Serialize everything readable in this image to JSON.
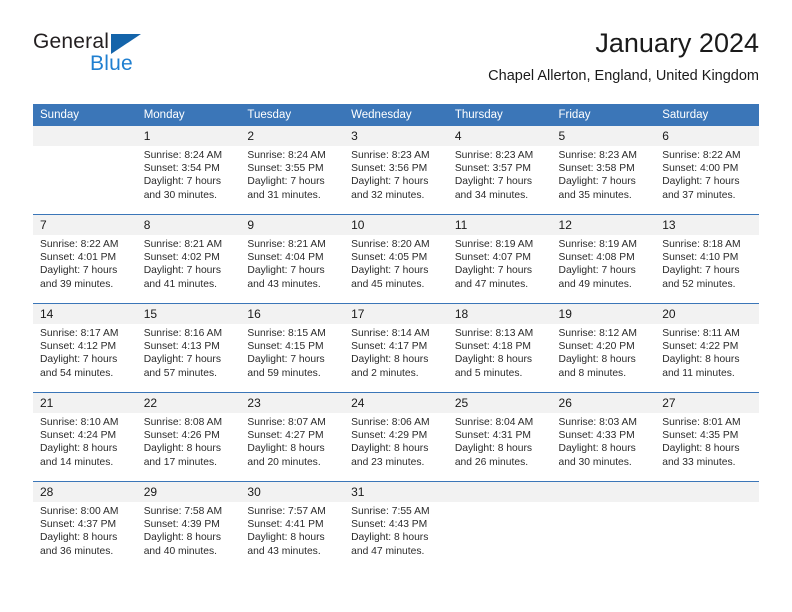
{
  "brand": {
    "name_part1": "General",
    "name_part2": "Blue",
    "triangle_color": "#1464aa",
    "blue_color": "#1f7fd0"
  },
  "header": {
    "title": "January 2024",
    "subtitle": "Chapel Allerton, England, United Kingdom",
    "header_bg": "#3b76b8",
    "daynum_bg": "#f2f2f2"
  },
  "weekday_headers": [
    "Sunday",
    "Monday",
    "Tuesday",
    "Wednesday",
    "Thursday",
    "Friday",
    "Saturday"
  ],
  "weeks": [
    [
      {
        "day": "",
        "sunrise": "",
        "sunset": "",
        "daylight_line1": "",
        "daylight_line2": ""
      },
      {
        "day": "1",
        "sunrise": "Sunrise: 8:24 AM",
        "sunset": "Sunset: 3:54 PM",
        "daylight_line1": "Daylight: 7 hours",
        "daylight_line2": "and 30 minutes."
      },
      {
        "day": "2",
        "sunrise": "Sunrise: 8:24 AM",
        "sunset": "Sunset: 3:55 PM",
        "daylight_line1": "Daylight: 7 hours",
        "daylight_line2": "and 31 minutes."
      },
      {
        "day": "3",
        "sunrise": "Sunrise: 8:23 AM",
        "sunset": "Sunset: 3:56 PM",
        "daylight_line1": "Daylight: 7 hours",
        "daylight_line2": "and 32 minutes."
      },
      {
        "day": "4",
        "sunrise": "Sunrise: 8:23 AM",
        "sunset": "Sunset: 3:57 PM",
        "daylight_line1": "Daylight: 7 hours",
        "daylight_line2": "and 34 minutes."
      },
      {
        "day": "5",
        "sunrise": "Sunrise: 8:23 AM",
        "sunset": "Sunset: 3:58 PM",
        "daylight_line1": "Daylight: 7 hours",
        "daylight_line2": "and 35 minutes."
      },
      {
        "day": "6",
        "sunrise": "Sunrise: 8:22 AM",
        "sunset": "Sunset: 4:00 PM",
        "daylight_line1": "Daylight: 7 hours",
        "daylight_line2": "and 37 minutes."
      }
    ],
    [
      {
        "day": "7",
        "sunrise": "Sunrise: 8:22 AM",
        "sunset": "Sunset: 4:01 PM",
        "daylight_line1": "Daylight: 7 hours",
        "daylight_line2": "and 39 minutes."
      },
      {
        "day": "8",
        "sunrise": "Sunrise: 8:21 AM",
        "sunset": "Sunset: 4:02 PM",
        "daylight_line1": "Daylight: 7 hours",
        "daylight_line2": "and 41 minutes."
      },
      {
        "day": "9",
        "sunrise": "Sunrise: 8:21 AM",
        "sunset": "Sunset: 4:04 PM",
        "daylight_line1": "Daylight: 7 hours",
        "daylight_line2": "and 43 minutes."
      },
      {
        "day": "10",
        "sunrise": "Sunrise: 8:20 AM",
        "sunset": "Sunset: 4:05 PM",
        "daylight_line1": "Daylight: 7 hours",
        "daylight_line2": "and 45 minutes."
      },
      {
        "day": "11",
        "sunrise": "Sunrise: 8:19 AM",
        "sunset": "Sunset: 4:07 PM",
        "daylight_line1": "Daylight: 7 hours",
        "daylight_line2": "and 47 minutes."
      },
      {
        "day": "12",
        "sunrise": "Sunrise: 8:19 AM",
        "sunset": "Sunset: 4:08 PM",
        "daylight_line1": "Daylight: 7 hours",
        "daylight_line2": "and 49 minutes."
      },
      {
        "day": "13",
        "sunrise": "Sunrise: 8:18 AM",
        "sunset": "Sunset: 4:10 PM",
        "daylight_line1": "Daylight: 7 hours",
        "daylight_line2": "and 52 minutes."
      }
    ],
    [
      {
        "day": "14",
        "sunrise": "Sunrise: 8:17 AM",
        "sunset": "Sunset: 4:12 PM",
        "daylight_line1": "Daylight: 7 hours",
        "daylight_line2": "and 54 minutes."
      },
      {
        "day": "15",
        "sunrise": "Sunrise: 8:16 AM",
        "sunset": "Sunset: 4:13 PM",
        "daylight_line1": "Daylight: 7 hours",
        "daylight_line2": "and 57 minutes."
      },
      {
        "day": "16",
        "sunrise": "Sunrise: 8:15 AM",
        "sunset": "Sunset: 4:15 PM",
        "daylight_line1": "Daylight: 7 hours",
        "daylight_line2": "and 59 minutes."
      },
      {
        "day": "17",
        "sunrise": "Sunrise: 8:14 AM",
        "sunset": "Sunset: 4:17 PM",
        "daylight_line1": "Daylight: 8 hours",
        "daylight_line2": "and 2 minutes."
      },
      {
        "day": "18",
        "sunrise": "Sunrise: 8:13 AM",
        "sunset": "Sunset: 4:18 PM",
        "daylight_line1": "Daylight: 8 hours",
        "daylight_line2": "and 5 minutes."
      },
      {
        "day": "19",
        "sunrise": "Sunrise: 8:12 AM",
        "sunset": "Sunset: 4:20 PM",
        "daylight_line1": "Daylight: 8 hours",
        "daylight_line2": "and 8 minutes."
      },
      {
        "day": "20",
        "sunrise": "Sunrise: 8:11 AM",
        "sunset": "Sunset: 4:22 PM",
        "daylight_line1": "Daylight: 8 hours",
        "daylight_line2": "and 11 minutes."
      }
    ],
    [
      {
        "day": "21",
        "sunrise": "Sunrise: 8:10 AM",
        "sunset": "Sunset: 4:24 PM",
        "daylight_line1": "Daylight: 8 hours",
        "daylight_line2": "and 14 minutes."
      },
      {
        "day": "22",
        "sunrise": "Sunrise: 8:08 AM",
        "sunset": "Sunset: 4:26 PM",
        "daylight_line1": "Daylight: 8 hours",
        "daylight_line2": "and 17 minutes."
      },
      {
        "day": "23",
        "sunrise": "Sunrise: 8:07 AM",
        "sunset": "Sunset: 4:27 PM",
        "daylight_line1": "Daylight: 8 hours",
        "daylight_line2": "and 20 minutes."
      },
      {
        "day": "24",
        "sunrise": "Sunrise: 8:06 AM",
        "sunset": "Sunset: 4:29 PM",
        "daylight_line1": "Daylight: 8 hours",
        "daylight_line2": "and 23 minutes."
      },
      {
        "day": "25",
        "sunrise": "Sunrise: 8:04 AM",
        "sunset": "Sunset: 4:31 PM",
        "daylight_line1": "Daylight: 8 hours",
        "daylight_line2": "and 26 minutes."
      },
      {
        "day": "26",
        "sunrise": "Sunrise: 8:03 AM",
        "sunset": "Sunset: 4:33 PM",
        "daylight_line1": "Daylight: 8 hours",
        "daylight_line2": "and 30 minutes."
      },
      {
        "day": "27",
        "sunrise": "Sunrise: 8:01 AM",
        "sunset": "Sunset: 4:35 PM",
        "daylight_line1": "Daylight: 8 hours",
        "daylight_line2": "and 33 minutes."
      }
    ],
    [
      {
        "day": "28",
        "sunrise": "Sunrise: 8:00 AM",
        "sunset": "Sunset: 4:37 PM",
        "daylight_line1": "Daylight: 8 hours",
        "daylight_line2": "and 36 minutes."
      },
      {
        "day": "29",
        "sunrise": "Sunrise: 7:58 AM",
        "sunset": "Sunset: 4:39 PM",
        "daylight_line1": "Daylight: 8 hours",
        "daylight_line2": "and 40 minutes."
      },
      {
        "day": "30",
        "sunrise": "Sunrise: 7:57 AM",
        "sunset": "Sunset: 4:41 PM",
        "daylight_line1": "Daylight: 8 hours",
        "daylight_line2": "and 43 minutes."
      },
      {
        "day": "31",
        "sunrise": "Sunrise: 7:55 AM",
        "sunset": "Sunset: 4:43 PM",
        "daylight_line1": "Daylight: 8 hours",
        "daylight_line2": "and 47 minutes."
      },
      {
        "day": "",
        "sunrise": "",
        "sunset": "",
        "daylight_line1": "",
        "daylight_line2": ""
      },
      {
        "day": "",
        "sunrise": "",
        "sunset": "",
        "daylight_line1": "",
        "daylight_line2": ""
      },
      {
        "day": "",
        "sunrise": "",
        "sunset": "",
        "daylight_line1": "",
        "daylight_line2": ""
      }
    ]
  ]
}
